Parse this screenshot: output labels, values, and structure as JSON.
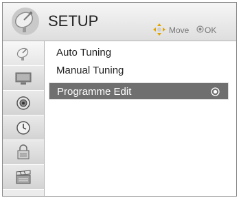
{
  "header": {
    "title": "SETUP",
    "hints": {
      "move_label": "Move",
      "ok_label": "OK"
    }
  },
  "sidebar": {
    "items": [
      {
        "icon": "satellite-dish-icon",
        "active": true
      },
      {
        "icon": "monitor-icon",
        "active": false
      },
      {
        "icon": "speaker-icon",
        "active": false
      },
      {
        "icon": "clock-icon",
        "active": false
      },
      {
        "icon": "lock-icon",
        "active": false
      },
      {
        "icon": "clapperboard-icon",
        "active": false
      }
    ]
  },
  "menu": {
    "items": [
      {
        "label": "Auto Tuning",
        "selected": false
      },
      {
        "label": "Manual Tuning",
        "selected": false
      },
      {
        "label": "Programme Edit",
        "selected": true
      }
    ]
  },
  "colors": {
    "selected_bg": "#6f6f6f",
    "header_bg": "#e6e6e6",
    "sidebar_bg": "#ececec"
  }
}
